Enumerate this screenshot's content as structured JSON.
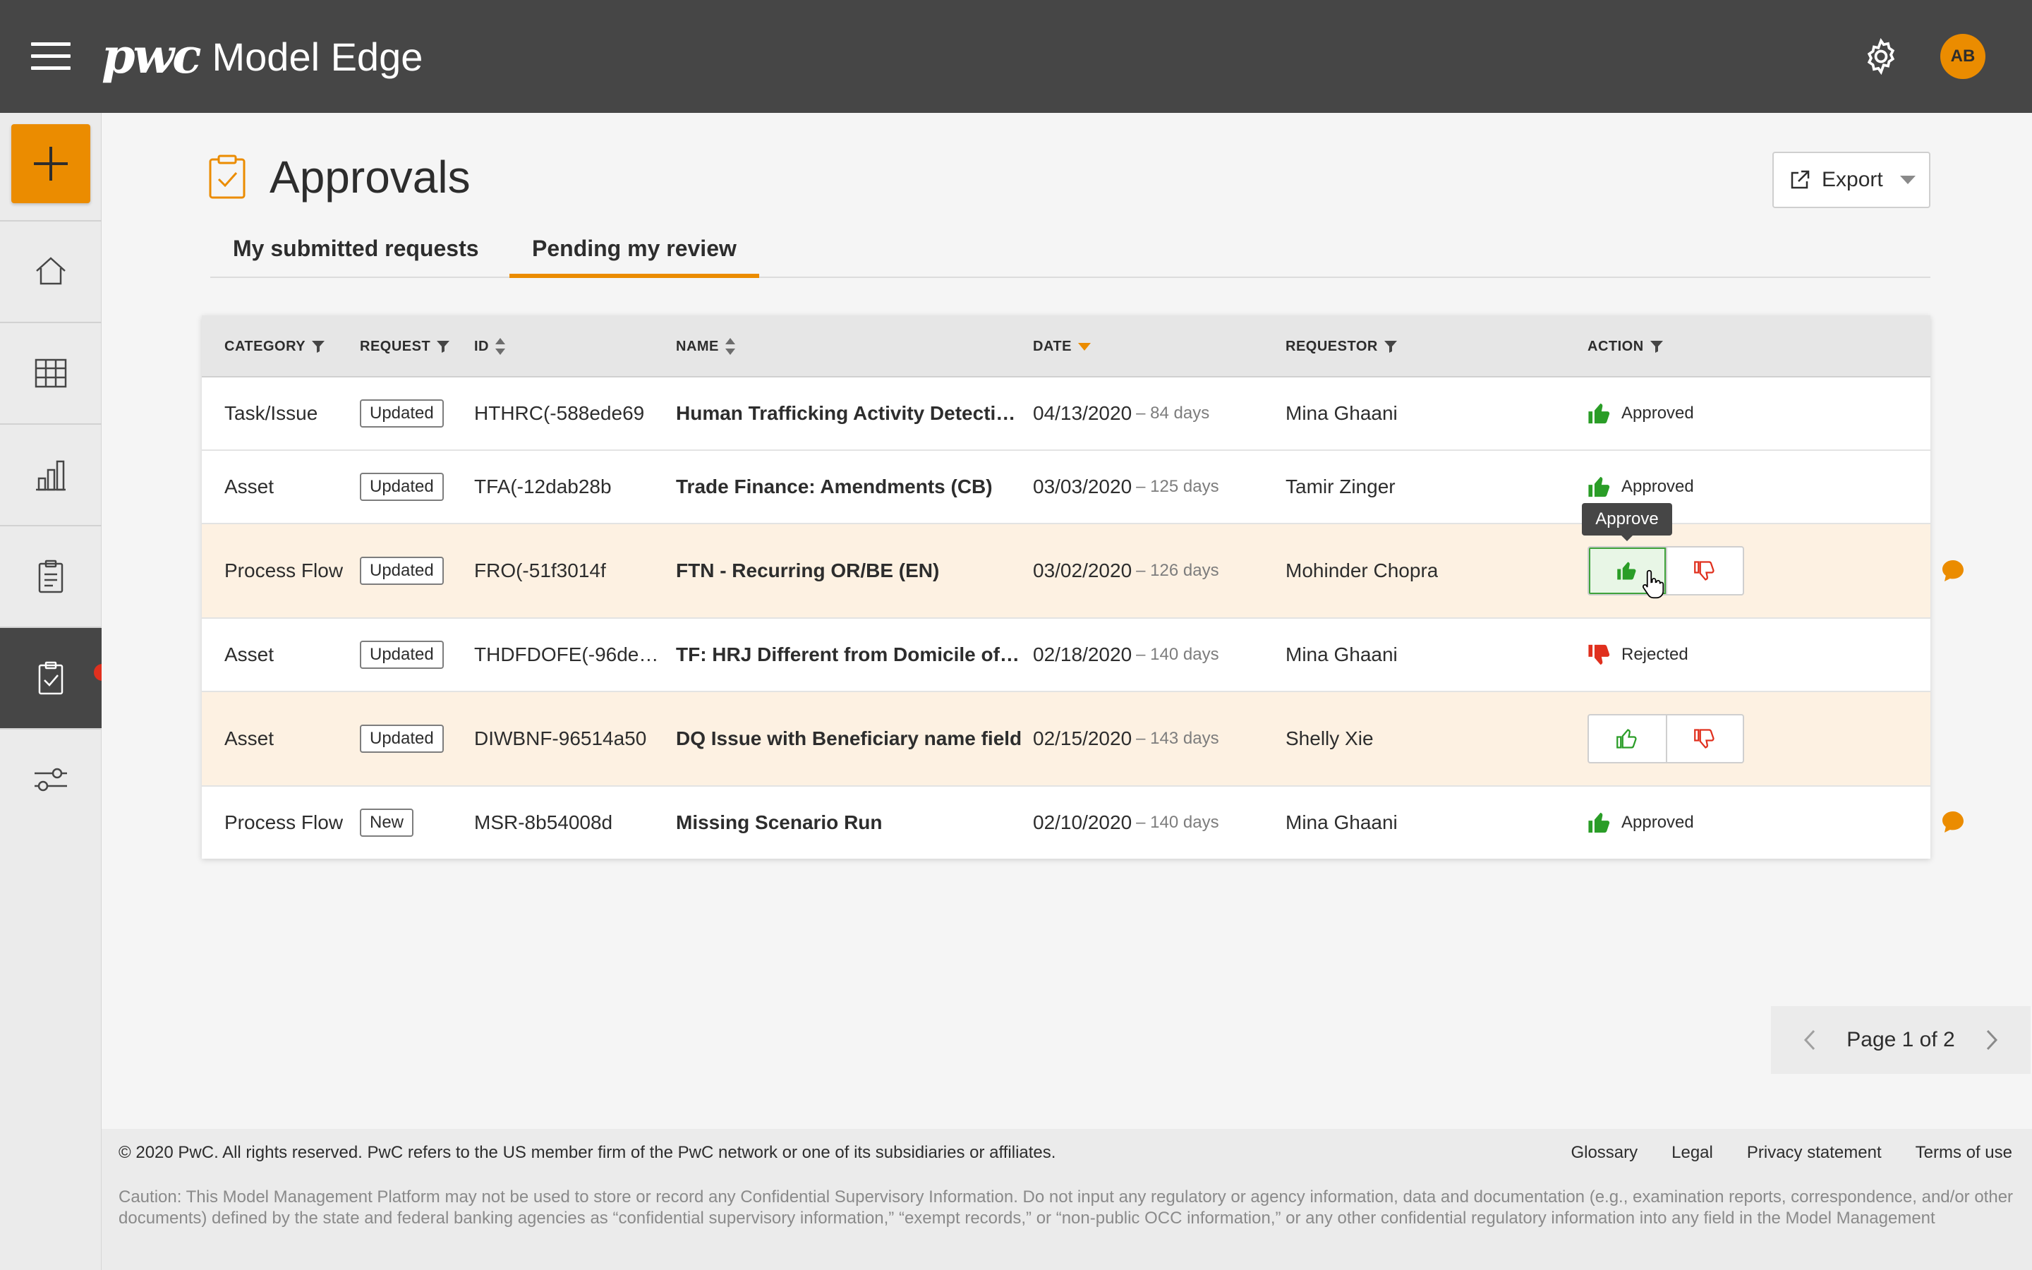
{
  "app": {
    "brand": "pwc",
    "name": "Model Edge"
  },
  "user": {
    "initials": "AB"
  },
  "page": {
    "title": "Approvals",
    "export_label": "Export"
  },
  "tabs": [
    {
      "label": "My submitted requests",
      "active": false
    },
    {
      "label": "Pending my review",
      "active": true
    }
  ],
  "table": {
    "headers": [
      "CATEGORY",
      "REQUEST",
      "ID",
      "NAME",
      "DATE",
      "REQUESTOR",
      "ACTION"
    ],
    "rows": [
      {
        "category": "Task/Issue",
        "request": "Updated",
        "id": "HTHRC(-588ede69",
        "name": "Human Trafficking Activity Detecti…",
        "date": "04/13/2020",
        "age": "– 84 days",
        "requestor": "Mina Ghaani",
        "action": "Approved"
      },
      {
        "category": "Asset",
        "request": "Updated",
        "id": "TFA(-12dab28b",
        "name": "Trade Finance: Amendments (CB)",
        "date": "03/03/2020",
        "age": "– 125 days",
        "requestor": "Tamir Zinger",
        "action": "Approved"
      },
      {
        "category": "Process Flow",
        "request": "Updated",
        "id": "FRO(-51f3014f",
        "name": "FTN - Recurring OR/BE (EN)",
        "date": "03/02/2020",
        "age": "– 126 days",
        "requestor": "Mohinder Chopra",
        "action": "pending"
      },
      {
        "category": "Asset",
        "request": "Updated",
        "id": "THDFDOFE(-96de…",
        "name": "TF: HRJ Different from Domicile of…",
        "date": "02/18/2020",
        "age": "– 140 days",
        "requestor": "Mina Ghaani",
        "action": "Rejected"
      },
      {
        "category": "Asset",
        "request": "Updated",
        "id": "DIWBNF-96514a50",
        "name": "DQ Issue with Beneficiary name field",
        "date": "02/15/2020",
        "age": "– 143 days",
        "requestor": "Shelly Xie",
        "action": "pending"
      },
      {
        "category": "Process Flow",
        "request": "New",
        "id": "MSR-8b54008d",
        "name": "Missing Scenario Run",
        "date": "02/10/2020",
        "age": "– 140 days",
        "requestor": "Mina Ghaani",
        "action": "Approved"
      }
    ]
  },
  "tooltip": "Approve",
  "pagination": {
    "label": "Page 1 of 2"
  },
  "footer": {
    "copyright": "© 2020 PwC. All rights reserved. PwC refers to the US member firm of the PwC network or one of its subsidiaries or affiliates.",
    "links": [
      "Glossary",
      "Legal",
      "Privacy statement",
      "Terms of use"
    ],
    "caution": "Caution: This Model Management Platform may not be used to store or record any Confidential Supervisory Information. Do not input any regulatory or agency information, data and documentation (e.g., examination reports, correspondence, and/or other documents) defined by the state and federal banking agencies as “confidential supervisory information,” “exempt records,” or “non-public OCC information,” or any other confidential regulatory information into any field in the Model Management"
  },
  "colors": {
    "accent": "#eb8c00",
    "approve": "#2a9d27",
    "reject": "#e0301e",
    "topbar": "#464646"
  }
}
